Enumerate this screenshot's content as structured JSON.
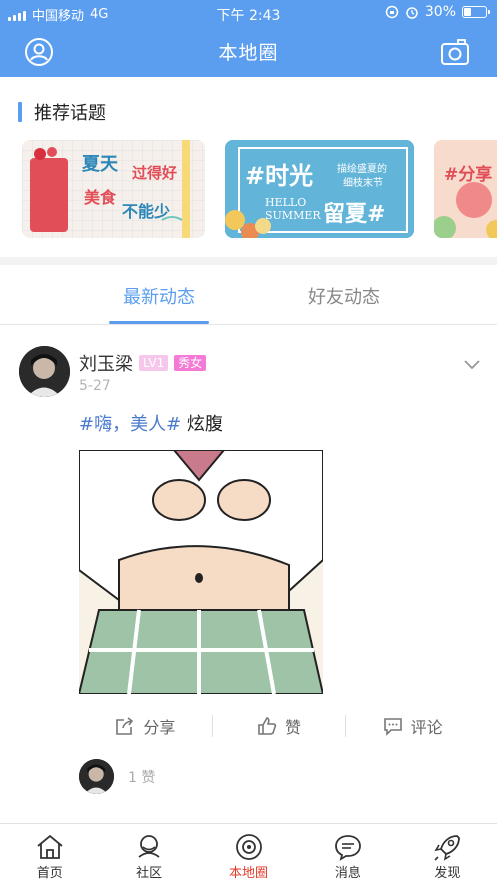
{
  "status_bar": {
    "carrier": "中国移动",
    "network": "4G",
    "time": "下午 2:43",
    "battery": "30%"
  },
  "header": {
    "title": "本地圈",
    "left_icon": "profile-icon",
    "right_icon": "camera-icon"
  },
  "topics": {
    "section_title": "推荐话题",
    "cards": [
      {
        "lines": [
          "夏天",
          "过得好",
          "美食",
          "不能少"
        ]
      },
      {
        "lines": [
          "#时光",
          "描绘盛夏的",
          "细枝末节",
          "HELLO",
          "SUMMER",
          "留夏#"
        ]
      },
      {
        "lines": [
          "#分享"
        ]
      }
    ]
  },
  "tabs": [
    {
      "label": "最新动态",
      "active": true
    },
    {
      "label": "好友动态",
      "active": false
    }
  ],
  "post": {
    "author": "刘玉梁",
    "level": "LV1",
    "tag": "秀女",
    "date": "5-27",
    "hashtag": "#嗨，美人#",
    "text": " 炫腹",
    "actions": {
      "share": "分享",
      "like": "赞",
      "comment": "评论"
    },
    "like_count": "1 赞"
  },
  "bottom_nav": [
    {
      "label": "首页",
      "icon": "home-icon",
      "active": false
    },
    {
      "label": "社区",
      "icon": "community-icon",
      "active": false
    },
    {
      "label": "本地圈",
      "icon": "local-circle-icon",
      "active": true
    },
    {
      "label": "消息",
      "icon": "message-icon",
      "active": false
    },
    {
      "label": "发现",
      "icon": "rocket-icon",
      "active": false
    }
  ],
  "colors": {
    "brand": "#5b9ef0",
    "active_nav": "#e33b2b",
    "hashtag": "#4a7bd0"
  }
}
